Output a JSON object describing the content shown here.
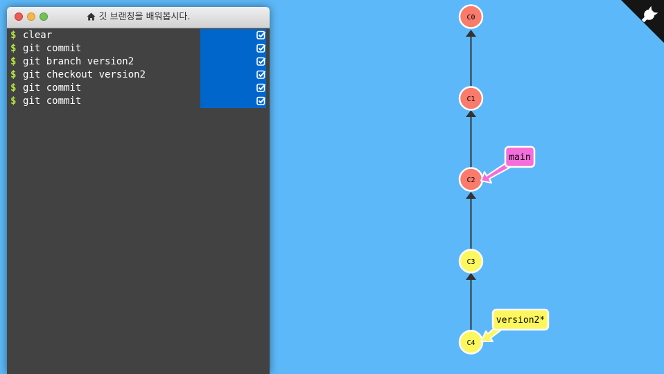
{
  "terminal": {
    "title": "깃 브랜칭을 배워봅시다.",
    "prompt_symbol": "$",
    "commands": [
      {
        "text": "clear",
        "completed": true
      },
      {
        "text": "git commit",
        "completed": true
      },
      {
        "text": "git branch version2",
        "completed": true
      },
      {
        "text": "git checkout version2",
        "completed": true
      },
      {
        "text": "git commit",
        "completed": true
      },
      {
        "text": "git commit",
        "completed": true
      }
    ]
  },
  "graph": {
    "commits": [
      {
        "id": "C0",
        "color": "#fa7b6c"
      },
      {
        "id": "C1",
        "color": "#fa7b6c"
      },
      {
        "id": "C2",
        "color": "#fa7b6c"
      },
      {
        "id": "C3",
        "color": "#fdf75f"
      },
      {
        "id": "C4",
        "color": "#fdf75f"
      }
    ],
    "branches": [
      {
        "name": "main",
        "target": "C2",
        "color": "#f56ddb"
      },
      {
        "name": "version2*",
        "target": "C4",
        "color": "#fdf75f"
      }
    ]
  },
  "colors": {
    "background": "#5cb8f8",
    "terminal_bg": "#424242",
    "completed_highlight": "#0066cc",
    "prompt": "#b6e93a"
  }
}
